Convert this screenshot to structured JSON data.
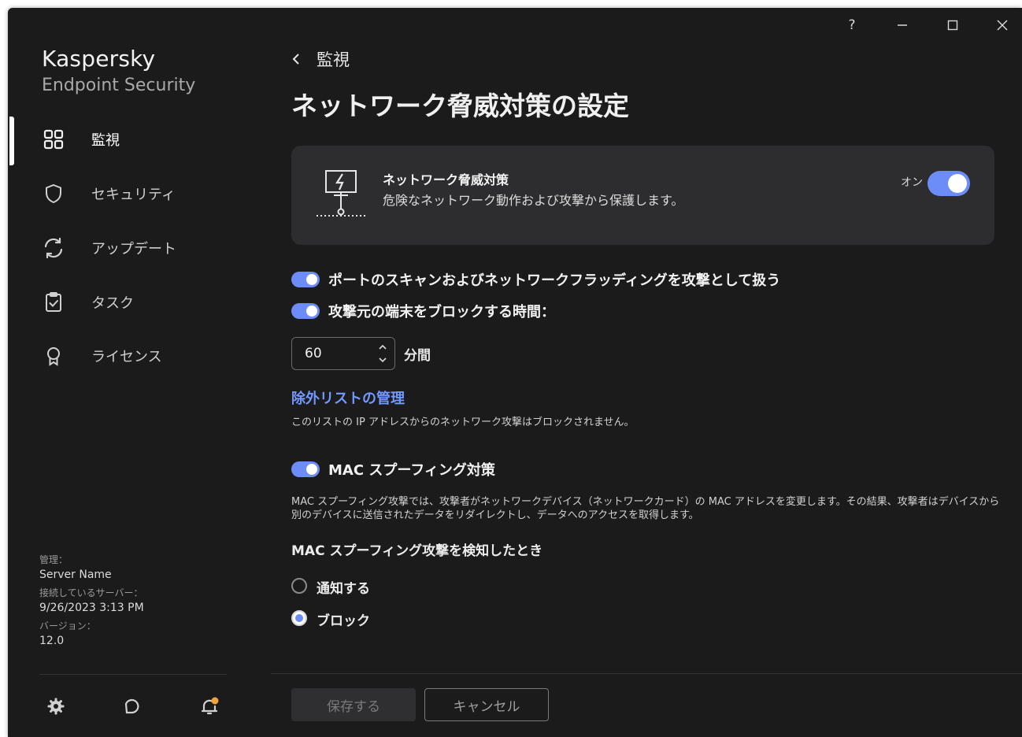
{
  "titlebar": {
    "help": "?",
    "minimize_icon": "minimize-icon",
    "maximize_icon": "maximize-icon",
    "close_icon": "close-icon"
  },
  "brand": {
    "name": "Kaspersky",
    "product": "Endpoint Security"
  },
  "sidebar": {
    "items": [
      {
        "label": "監視",
        "icon": "dashboard-icon",
        "active": true
      },
      {
        "label": "セキュリティ",
        "icon": "shield-icon",
        "active": false
      },
      {
        "label": "アップデート",
        "icon": "update-icon",
        "active": false
      },
      {
        "label": "タスク",
        "icon": "task-icon",
        "active": false
      },
      {
        "label": "ライセンス",
        "icon": "license-icon",
        "active": false
      }
    ],
    "info": {
      "managed_label": "管理：",
      "managed_value": "Server Name",
      "connected_label": "接続しているサーバー：",
      "connected_value": "9/26/2023 3:13 PM",
      "version_label": "バージョン：",
      "version_value": "12.0"
    },
    "bottom_icons": [
      "settings-icon",
      "support-icon",
      "notifications-icon"
    ]
  },
  "main": {
    "back_label": "監視",
    "title": "ネットワーク脅威対策の設定",
    "component": {
      "title": "ネットワーク脅威対策",
      "description": "危険なネットワーク動作および攻撃から保護します。",
      "state_label": "オン",
      "enabled": true
    },
    "port_scan_toggle": {
      "label": "ポートのスキャンおよびネットワークフラッディングを攻撃として扱う",
      "enabled": true
    },
    "block_time_toggle": {
      "label": "攻撃元の端末をブロックする時間：",
      "enabled": true
    },
    "block_time": {
      "value": "60",
      "unit": "分間"
    },
    "exclusions": {
      "link": "除外リストの管理",
      "note": "このリストの IP アドレスからのネットワーク攻撃はブロックされません。"
    },
    "mac_toggle": {
      "label": "MAC スプーフィング対策",
      "enabled": true
    },
    "mac_description_1": "MAC スプーフィング攻撃では、攻撃者がネットワークデバイス（ネットワークカード）の MAC アドレスを変更します。その結果、攻撃者はデバイスから",
    "mac_description_2": "別のデバイスに送信されたデータをリダイレクトし、データへのアクセスを取得します。",
    "mac_detect_heading": "MAC スプーフィング攻撃を検知したとき",
    "mac_actions": [
      {
        "label": "通知する",
        "selected": false
      },
      {
        "label": "ブロック",
        "selected": true
      }
    ]
  },
  "footer": {
    "save": "保存する",
    "cancel": "キャンセル"
  },
  "colors": {
    "accent": "#6c8cf7",
    "link": "#7398ff",
    "background": "#1b1b1b",
    "card": "#2d2d2f",
    "notification_dot": "#f0a43a"
  }
}
